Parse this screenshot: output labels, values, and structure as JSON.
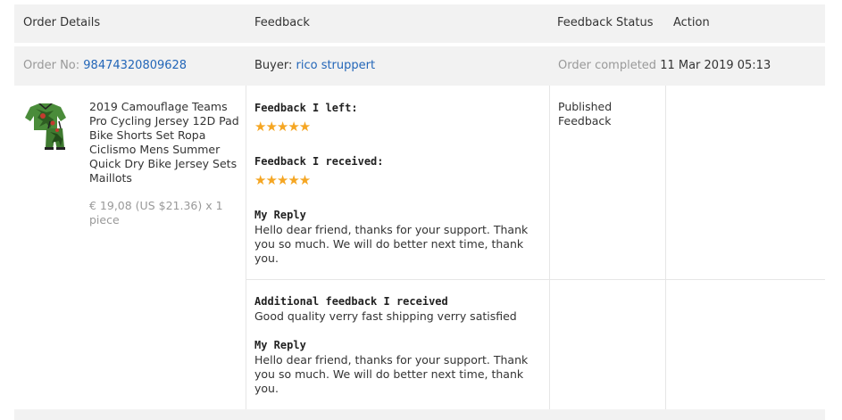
{
  "table": {
    "headers": {
      "order_details": "Order Details",
      "feedback": "Feedback",
      "feedback_status": "Feedback Status",
      "action": "Action"
    }
  },
  "order": {
    "order_no_label": "Order No:",
    "order_no": "98474320809628",
    "buyer_label": "Buyer:",
    "buyer_name": "rico struppert",
    "status_label": "Order completed",
    "date": "11 Mar 2019 05:13"
  },
  "product": {
    "title": "2019 Camouflage Teams Pro Cycling Jersey 12D Pad Bike Shorts Set Ropa Ciclismo Mens Summer Quick Dry Bike Jersey Sets Maillots",
    "price": "€ 19,08 (US $21.36) x 1 piece",
    "image_icon": "cycling-jersey-shorts-set-image"
  },
  "feedback": {
    "left_label": "Feedback I left:",
    "left_rating": 5,
    "received_label": "Feedback I received:",
    "received_rating": 5,
    "reply_label": "My Reply",
    "reply_text": "Hello dear friend, thanks for your support. Thank you so much. We will do better next time, thank you.",
    "additional_label": "Additional feedback I received",
    "additional_text": "Good quality verry fast shipping verry satisfied",
    "reply2_label": "My Reply",
    "reply2_text": "Hello dear friend, thanks for your support. Thank you so much. We will do better next time, thank you.",
    "star_glyph": "★★★★★",
    "star_color": "#f5a623"
  },
  "status": {
    "text": "Published Feedback"
  },
  "colors": {
    "link": "#2366b8",
    "muted": "#999999",
    "header_bg": "#f2f2f2"
  }
}
